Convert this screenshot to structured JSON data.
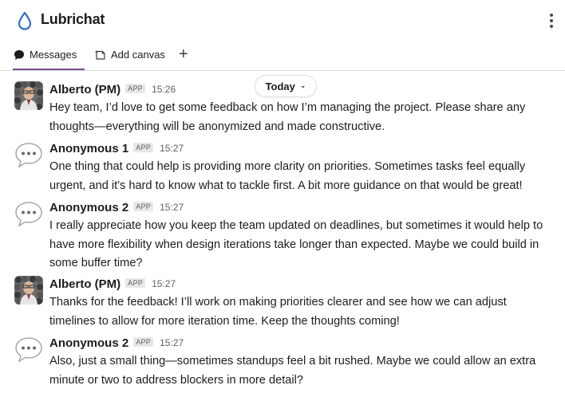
{
  "header": {
    "channel_name": "Lubrichat",
    "icon": "water-drop-icon",
    "more_icon": "kebab-menu-icon"
  },
  "tabs": [
    {
      "label": "Messages",
      "icon": "message-bubble-icon",
      "active": true
    },
    {
      "label": "Add canvas",
      "icon": "canvas-icon",
      "active": false
    }
  ],
  "add_tab_label": "+",
  "date_divider": {
    "label": "Today",
    "icon": "chevron-down-icon"
  },
  "messages": [
    {
      "sender": "Alberto (PM)",
      "badge": "APP",
      "time": "15:26",
      "avatar": "person-photo-avatar",
      "text": "Hey team, I’d love to get some feedback on how I’m managing the project. Please share any\nthoughts—everything will be anonymized and made constructive."
    },
    {
      "sender": "Anonymous 1",
      "badge": "APP",
      "time": "15:27",
      "avatar": "speech-bubble-avatar",
      "text": "One thing that could help is providing more clarity on priorities. Sometimes tasks feel equally\nurgent, and it's hard to know what to tackle first. A bit more guidance on that would be great!"
    },
    {
      "sender": "Anonymous 2",
      "badge": "APP",
      "time": "15:27",
      "avatar": "speech-bubble-avatar",
      "text": "I really appreciate how you keep the team updated on deadlines, but sometimes it would help to\nhave more flexibility when design iterations take longer than expected. Maybe we could build in\nsome buffer time?"
    },
    {
      "sender": "Alberto (PM)",
      "badge": "APP",
      "time": "15:27",
      "avatar": "person-photo-avatar",
      "text": "Thanks for the feedback! I’ll work on making priorities clearer and see how we can adjust\ntimelines to allow for more iteration time. Keep the thoughts coming!"
    },
    {
      "sender": "Anonymous 2",
      "badge": "APP",
      "time": "15:27",
      "avatar": "speech-bubble-avatar",
      "text": "Also, just a small thing—sometimes standups feel a bit rushed. Maybe we could allow an extra\nminute or two to address blockers in more detail?"
    }
  ],
  "colors": {
    "accent_tab_underline": "#7c4b8e",
    "drop_icon": "#2d6fb8",
    "text_primary": "#1d1c1d",
    "text_secondary": "#616061"
  }
}
